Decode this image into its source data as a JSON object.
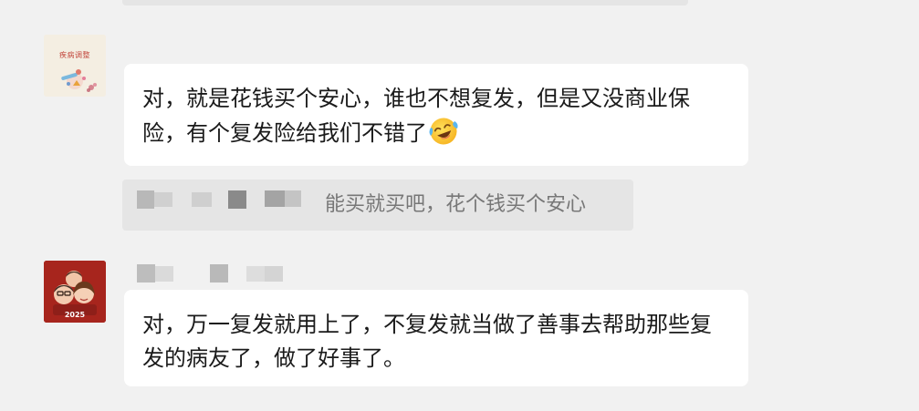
{
  "messages": [
    {
      "avatar_text": "疾病调整",
      "text": "对，就是花钱买个安心，谁也不想复发，但是又没商业保险，有个复发险给我们不错了",
      "emoji": "face-with-tears-of-joy"
    },
    {
      "sender_name_visible": false,
      "avatar_text": "2025",
      "text": "对，万一复发就用上了，不复发就当做了善事去帮助那些复发的病友了，做了好事了。"
    }
  ],
  "quote": {
    "sender_name_visible": false,
    "text": "能买就买吧，花个钱买个安心"
  },
  "colors": {
    "background": "#f1f1f1",
    "bubble": "#ffffff",
    "quote_background": "#e5e5e5",
    "quote_text": "#777777",
    "message_text": "#1a1a1a",
    "avatar2_background": "#a7251d"
  }
}
